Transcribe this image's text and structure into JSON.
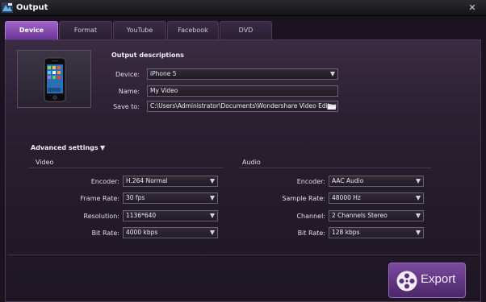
{
  "window": {
    "title": "Output",
    "close_glyph": "✕"
  },
  "tabs": [
    {
      "label": "Device",
      "active": true
    },
    {
      "label": "Format",
      "active": false
    },
    {
      "label": "YouTube",
      "active": false
    },
    {
      "label": "Facebook",
      "active": false
    },
    {
      "label": "DVD",
      "active": false
    }
  ],
  "output": {
    "heading": "Output descriptions",
    "device_label": "Device:",
    "device_value": "iPhone 5",
    "name_label": "Name:",
    "name_value": "My Video",
    "saveto_label": "Save to:",
    "saveto_value": "C:\\Users\\Administrator\\Documents\\Wondershare Video Editor"
  },
  "advanced": {
    "heading": "Advanced settings",
    "toggle_glyph": "▼",
    "video": {
      "heading": "Video",
      "encoder_label": "Encoder:",
      "encoder_value": "H.264 Normal",
      "framerate_label": "Frame Rate:",
      "framerate_value": "30 fps",
      "resolution_label": "Resolution:",
      "resolution_value": "1136*640",
      "bitrate_label": "Bit Rate:",
      "bitrate_value": "4000 kbps"
    },
    "audio": {
      "heading": "Audio",
      "encoder_label": "Encoder:",
      "encoder_value": "AAC Audio",
      "samplerate_label": "Sample Rate:",
      "samplerate_value": "48000 Hz",
      "channel_label": "Channel:",
      "channel_value": "2 Channels Stereo",
      "bitrate_label": "Bit Rate:",
      "bitrate_value": "128 kbps"
    }
  },
  "export_button": {
    "label": "Export"
  },
  "colors": {
    "accent": "#8a4fb8",
    "background": "#1b1420",
    "panel": "#2a2031"
  },
  "icons": [
    "app-logo-icon",
    "close-icon",
    "phone-icon",
    "folder-icon",
    "dropdown-arrow-icon",
    "film-icon"
  ]
}
